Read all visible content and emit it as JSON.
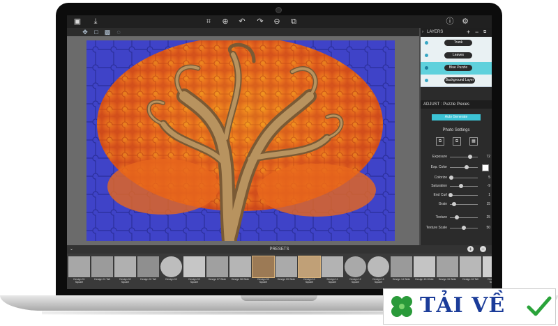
{
  "toolbar": {
    "left_icons": [
      "image-icon",
      "save-icon"
    ],
    "center_icons": [
      "crop-icon",
      "zoom-in-icon",
      "undo-icon",
      "redo-icon",
      "zoom-out-icon",
      "fit-icon"
    ],
    "right_icons": [
      "info-icon",
      "settings-icon"
    ],
    "sub_icons": [
      "move-icon",
      "select-icon",
      "portrait-icon",
      "bulb-icon"
    ]
  },
  "layers": {
    "title": "LAYERS",
    "add": "+",
    "remove": "−",
    "items": [
      {
        "name": "Trunk",
        "active": false
      },
      {
        "name": "Leaves",
        "active": false
      },
      {
        "name": "Blue Puzzle",
        "active": true
      },
      {
        "name": "Background Layer",
        "active": false
      }
    ]
  },
  "adjust": {
    "title": "ADJUST : Puzzle Pieces",
    "auto_button": "Auto Generate",
    "section": "Photo Settings",
    "sliders": [
      {
        "label": "Exposure",
        "value": "72",
        "pos": 0.72
      },
      {
        "label": "Exp. Color",
        "value": "",
        "pos": 0.6,
        "swatch": "#ffffff"
      },
      {
        "label": "Colorize",
        "value": "5",
        "pos": 0.05
      },
      {
        "label": "Saturation",
        "value": "-9",
        "pos": 0.41
      },
      {
        "label": "End Curl",
        "value": "1",
        "pos": 0.02
      },
      {
        "label": "Grain",
        "value": "15",
        "pos": 0.15
      },
      {
        "label": "Texture",
        "value": "25",
        "pos": 0.25
      },
      {
        "label": "Texture Scale",
        "value": "50",
        "pos": 0.5
      }
    ]
  },
  "presets": {
    "title": "PRESETS",
    "items": [
      {
        "line1": "Design 01",
        "line2": "Square"
      },
      {
        "line1": "Design 01 Tall",
        "line2": ""
      },
      {
        "line1": "Design 02",
        "line2": "Square"
      },
      {
        "line1": "Design 02 Tall",
        "line2": ""
      },
      {
        "line1": "Design 03",
        "line2": ""
      },
      {
        "line1": "Design 03",
        "line2": "Square"
      },
      {
        "line1": "Design 07 Wide",
        "line2": ""
      },
      {
        "line1": "Design 08 Wide",
        "line2": ""
      },
      {
        "line1": "Design 09",
        "line2": "Square"
      },
      {
        "line1": "Design 09 Wide",
        "line2": ""
      },
      {
        "line1": "Design 10",
        "line2": "Square"
      },
      {
        "line1": "Design 11",
        "line2": "Square"
      },
      {
        "line1": "Design 12",
        "line2": "Square"
      },
      {
        "line1": "Design 13",
        "line2": "Square"
      },
      {
        "line1": "Design 14 Wide",
        "line2": ""
      },
      {
        "line1": "Design 15 White",
        "line2": ""
      },
      {
        "line1": "Design 15 Wide",
        "line2": ""
      },
      {
        "line1": "Design 16 Tall",
        "line2": ""
      },
      {
        "line1": "Design 17",
        "line2": "Square"
      },
      {
        "line1": "Desi",
        "line2": ""
      }
    ]
  },
  "watermark": {
    "text": "TẢI VỀ"
  },
  "colors": {
    "accent": "#3cc3d5",
    "bezel": "#0c0c0c",
    "puzzle_blue": "#3b3fc9",
    "puzzle_orange": "#e8681d"
  }
}
